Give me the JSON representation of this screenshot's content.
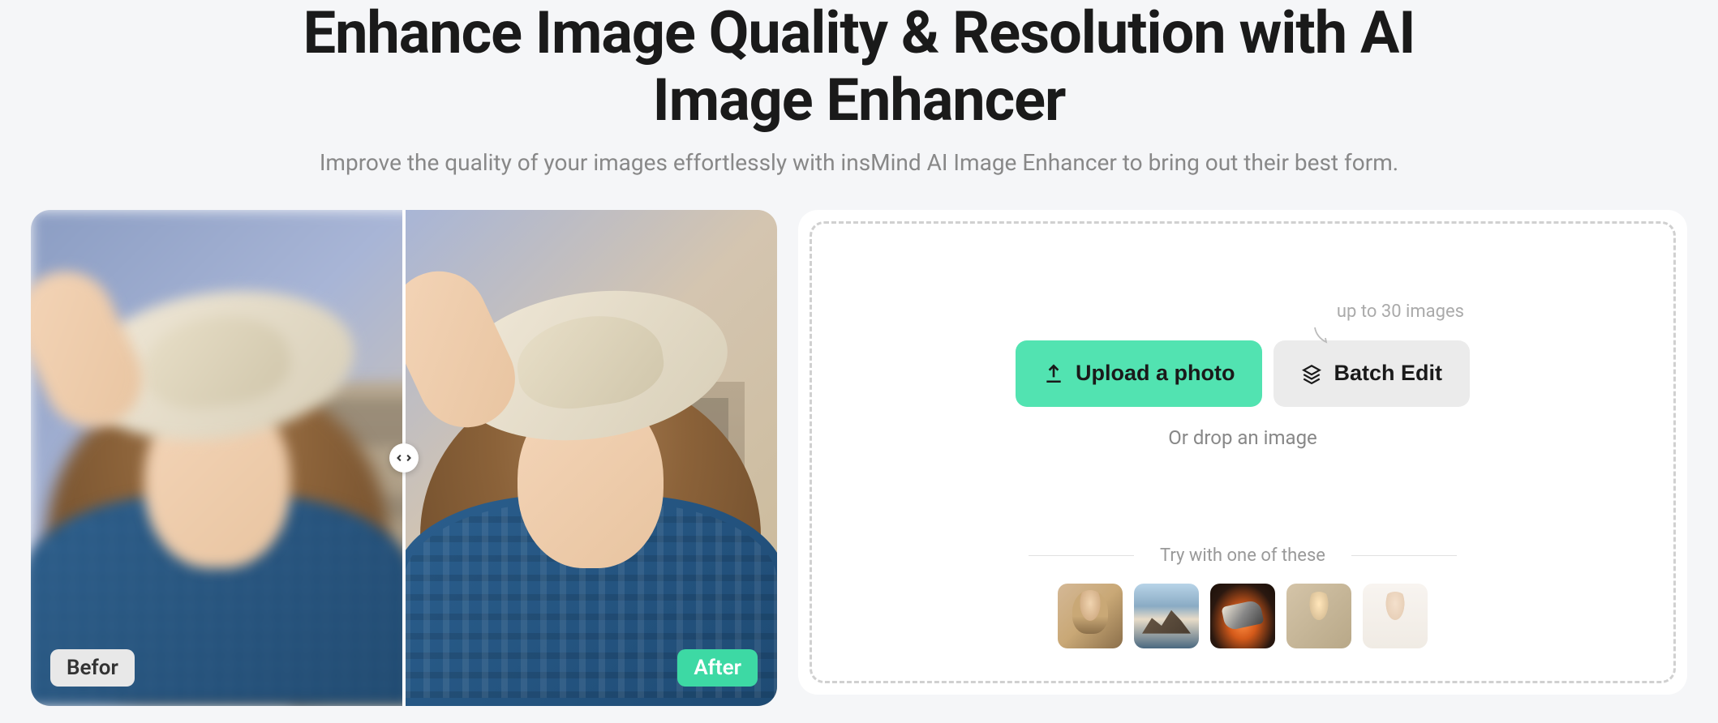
{
  "header": {
    "title_line1": "Enhance Image Quality & Resolution with AI",
    "title_line2": "Image Enhancer",
    "subtitle": "Improve the quality of your images effortlessly with insMind AI Image Enhancer to bring out their best form."
  },
  "preview": {
    "before_label": "Befor",
    "after_label": "After"
  },
  "upload": {
    "hint": "up to 30 images",
    "upload_button": "Upload a photo",
    "batch_button": "Batch Edit",
    "drop_text": "Or drop an image",
    "samples_label": "Try with one of these"
  },
  "colors": {
    "accent": "#52e3b1",
    "accent_dark": "#3dd9a4"
  }
}
